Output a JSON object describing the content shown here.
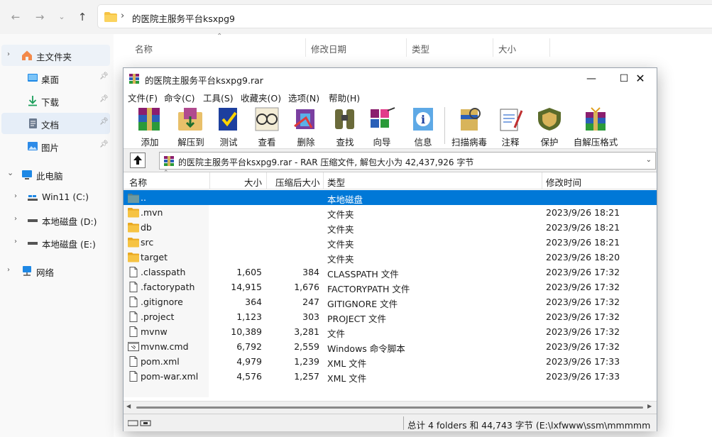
{
  "explorer": {
    "path_sep": "›",
    "path": "的医院主服务平台ksxpg9",
    "columns": [
      "名称",
      "修改日期",
      "类型",
      "大小"
    ],
    "sidebar": [
      {
        "label": "主文件夹",
        "icon": "home-icon"
      },
      {
        "label": "桌面",
        "icon": "desktop-icon"
      },
      {
        "label": "下载",
        "icon": "download-icon"
      },
      {
        "label": "文档",
        "icon": "document-icon"
      },
      {
        "label": "图片",
        "icon": "picture-icon"
      },
      {
        "label": "此电脑",
        "icon": "computer-icon"
      },
      {
        "label": "Win11 (C:)",
        "icon": "windows-drive-icon"
      },
      {
        "label": "本地磁盘 (D:)",
        "icon": "drive-icon"
      },
      {
        "label": "本地磁盘 (E:)",
        "icon": "drive-icon"
      },
      {
        "label": "网络",
        "icon": "network-icon"
      }
    ]
  },
  "winrar": {
    "title": "的医院主服务平台ksxpg9.rar",
    "menu": [
      "文件(F)",
      "命令(C)",
      "工具(S)",
      "收藏夹(O)",
      "选项(N)",
      "帮助(H)"
    ],
    "toolbar": [
      "添加",
      "解压到",
      "测试",
      "查看",
      "删除",
      "查找",
      "向导",
      "信息",
      "扫描病毒",
      "注释",
      "保护",
      "自解压格式"
    ],
    "path_display": "的医院主服务平台ksxpg9.rar - RAR 压缩文件, 解包大小为 42,437,926 字节",
    "columns": {
      "name": "名称",
      "size": "大小",
      "packed": "压缩后大小",
      "type": "类型",
      "modified": "修改时间"
    },
    "files": [
      {
        "name": "..",
        "size": "",
        "packed": "",
        "type": "本地磁盘",
        "modified": "",
        "kind": "up"
      },
      {
        "name": ".mvn",
        "size": "",
        "packed": "",
        "type": "文件夹",
        "modified": "2023/9/26 18:21",
        "kind": "folder"
      },
      {
        "name": "db",
        "size": "",
        "packed": "",
        "type": "文件夹",
        "modified": "2023/9/26 18:21",
        "kind": "folder"
      },
      {
        "name": "src",
        "size": "",
        "packed": "",
        "type": "文件夹",
        "modified": "2023/9/26 18:21",
        "kind": "folder"
      },
      {
        "name": "target",
        "size": "",
        "packed": "",
        "type": "文件夹",
        "modified": "2023/9/26 18:20",
        "kind": "folder"
      },
      {
        "name": ".classpath",
        "size": "1,605",
        "packed": "384",
        "type": "CLASSPATH 文件",
        "modified": "2023/9/26 17:32",
        "kind": "file"
      },
      {
        "name": ".factorypath",
        "size": "14,915",
        "packed": "1,676",
        "type": "FACTORYPATH 文件",
        "modified": "2023/9/26 17:32",
        "kind": "file"
      },
      {
        "name": ".gitignore",
        "size": "364",
        "packed": "247",
        "type": "GITIGNORE 文件",
        "modified": "2023/9/26 17:32",
        "kind": "file"
      },
      {
        "name": ".project",
        "size": "1,123",
        "packed": "303",
        "type": "PROJECT 文件",
        "modified": "2023/9/26 17:32",
        "kind": "file"
      },
      {
        "name": "mvnw",
        "size": "10,389",
        "packed": "3,281",
        "type": "文件",
        "modified": "2023/9/26 17:32",
        "kind": "file"
      },
      {
        "name": "mvnw.cmd",
        "size": "6,792",
        "packed": "2,559",
        "type": "Windows 命令脚本",
        "modified": "2023/9/26 17:32",
        "kind": "script"
      },
      {
        "name": "pom.xml",
        "size": "4,979",
        "packed": "1,239",
        "type": "XML 文件",
        "modified": "2023/9/26 17:33",
        "kind": "file"
      },
      {
        "name": "pom-war.xml",
        "size": "4,576",
        "packed": "1,257",
        "type": "XML 文件",
        "modified": "2023/9/26 17:33",
        "kind": "file"
      }
    ],
    "status": "总计 4 folders 和 44,743 字节 (E:\\lxfwww\\ssm\\mmmmm"
  },
  "colors": {
    "selection": "#0078d7",
    "folder": "#f6c343"
  }
}
